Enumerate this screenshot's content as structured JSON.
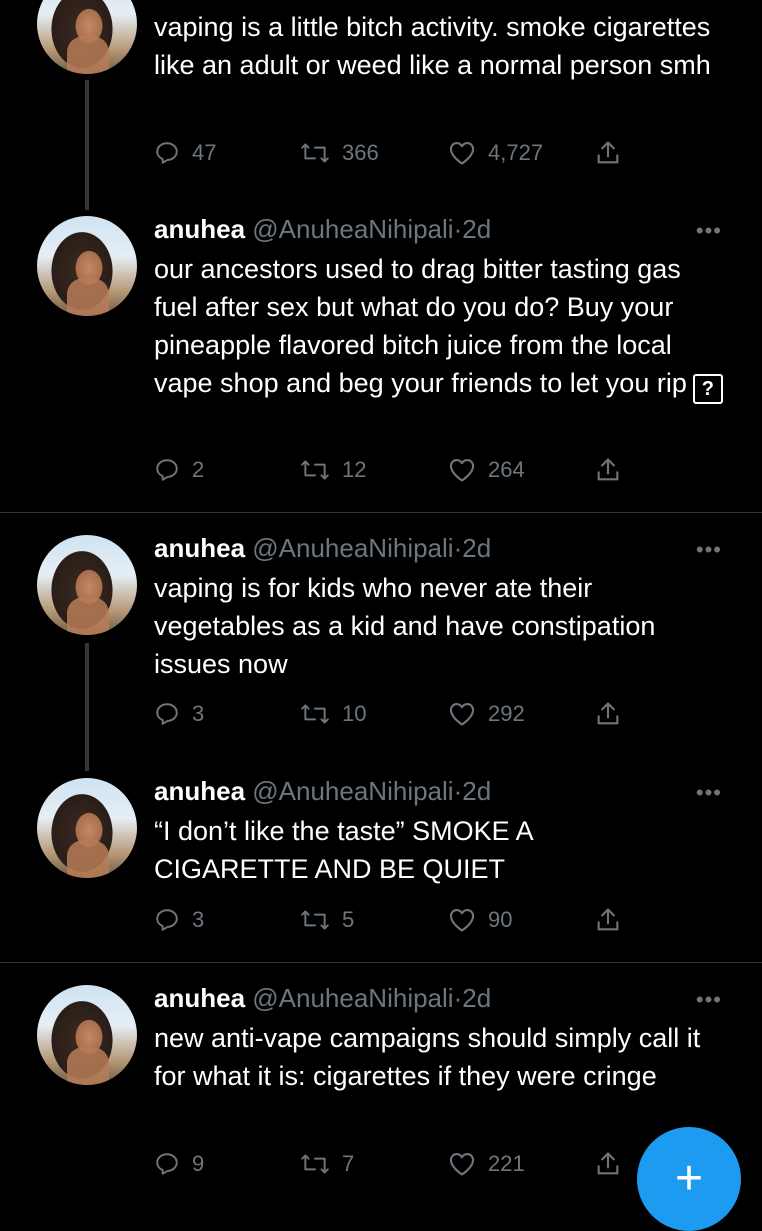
{
  "tweets": [
    {
      "name": "",
      "handle": "",
      "time": "",
      "text": "vaping is a little bitch activity. smoke cigarettes like an adult or weed like a normal person smh",
      "replies": "47",
      "retweets": "366",
      "likes": "4,727"
    },
    {
      "name": "anuhea",
      "handle": "@AnuheaNihipali",
      "time": "2d",
      "text": "our ancestors used to drag bitter tasting gas fuel after sex but what do you do? Buy your pineapple flavored bitch juice from the local vape shop and beg your friends to let you rip",
      "emoji_fallback": "?",
      "replies": "2",
      "retweets": "12",
      "likes": "264"
    },
    {
      "name": "anuhea",
      "handle": "@AnuheaNihipali",
      "time": "2d",
      "text": "vaping is for kids who never ate their vegetables as a kid and have constipation issues now",
      "replies": "3",
      "retweets": "10",
      "likes": "292"
    },
    {
      "name": "anuhea",
      "handle": "@AnuheaNihipali",
      "time": "2d",
      "text": "“I don’t like the taste” SMOKE A CIGARETTE AND BE QUIET",
      "replies": "3",
      "retweets": "5",
      "likes": "90"
    },
    {
      "name": "anuhea",
      "handle": "@AnuheaNihipali",
      "time": "2d",
      "text": "new anti-vape campaigns should simply call it for what it is: cigarettes if they were cringe",
      "replies": "9",
      "retweets": "7",
      "likes": "221"
    }
  ],
  "ui": {
    "more_glyph": "•••",
    "separator": "·",
    "compose_glyph": "+"
  },
  "colors": {
    "background": "#000000",
    "muted": "#6e767d",
    "accent": "#1d9bf0",
    "divider": "#2f3336"
  },
  "icons": [
    "reply-icon",
    "retweet-icon",
    "like-icon",
    "share-icon",
    "compose-icon",
    "more-icon"
  ]
}
